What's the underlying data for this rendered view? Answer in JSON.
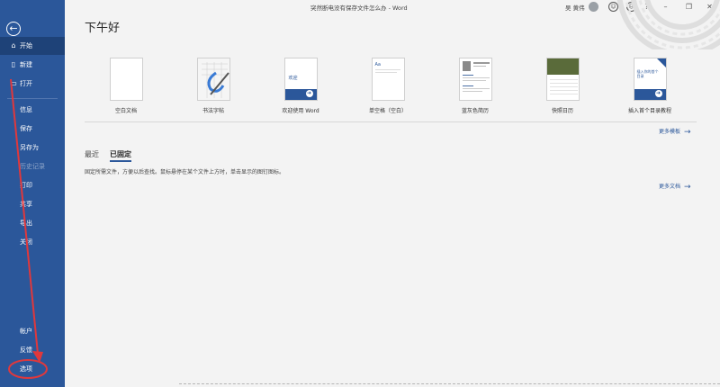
{
  "window": {
    "title": "突然断电没有保存文件怎么办 - Word",
    "user": "吴 黄伟",
    "icons": [
      "smiley-icon",
      "frown-icon",
      "question-icon",
      "minimize-icon",
      "restore-icon",
      "close-icon"
    ]
  },
  "greeting": "下午好",
  "sidebar": {
    "back_icon": "←",
    "items": [
      {
        "label": "开始",
        "icon": "⌂"
      },
      {
        "label": "新建",
        "icon": "▯"
      },
      {
        "label": "打开",
        "icon": "▭"
      },
      {
        "label": "信息"
      },
      {
        "label": "保存"
      },
      {
        "label": "另存为"
      },
      {
        "label": "历史记录"
      },
      {
        "label": "打印"
      },
      {
        "label": "共享"
      },
      {
        "label": "导出"
      },
      {
        "label": "关闭"
      },
      {
        "label": "帐户"
      },
      {
        "label": "反馈"
      },
      {
        "label": "选项"
      }
    ]
  },
  "templates": [
    {
      "label": "空白文档"
    },
    {
      "label": "书法字帖"
    },
    {
      "label": "欢迎使用 Word",
      "thumb_text": "欢迎"
    },
    {
      "label": "单空格（空白）",
      "thumb_text": "Aa"
    },
    {
      "label": "蓝灰色简历"
    },
    {
      "label": "快照日历"
    },
    {
      "label": "插入首个目录教程",
      "thumb_text": "插入你的首个目录"
    }
  ],
  "more_templates": "更多模板",
  "tabs": {
    "recent": "最近",
    "pinned": "已固定"
  },
  "pinned_info": "固定所需文件，方便以后查找。鼠标悬停在某个文件上方时，单击显示的图钉图标。",
  "more_docs": "更多文档",
  "colors": {
    "sidebar": "#2b579a",
    "active": "#1e4278",
    "annotation": "#e0383c"
  }
}
